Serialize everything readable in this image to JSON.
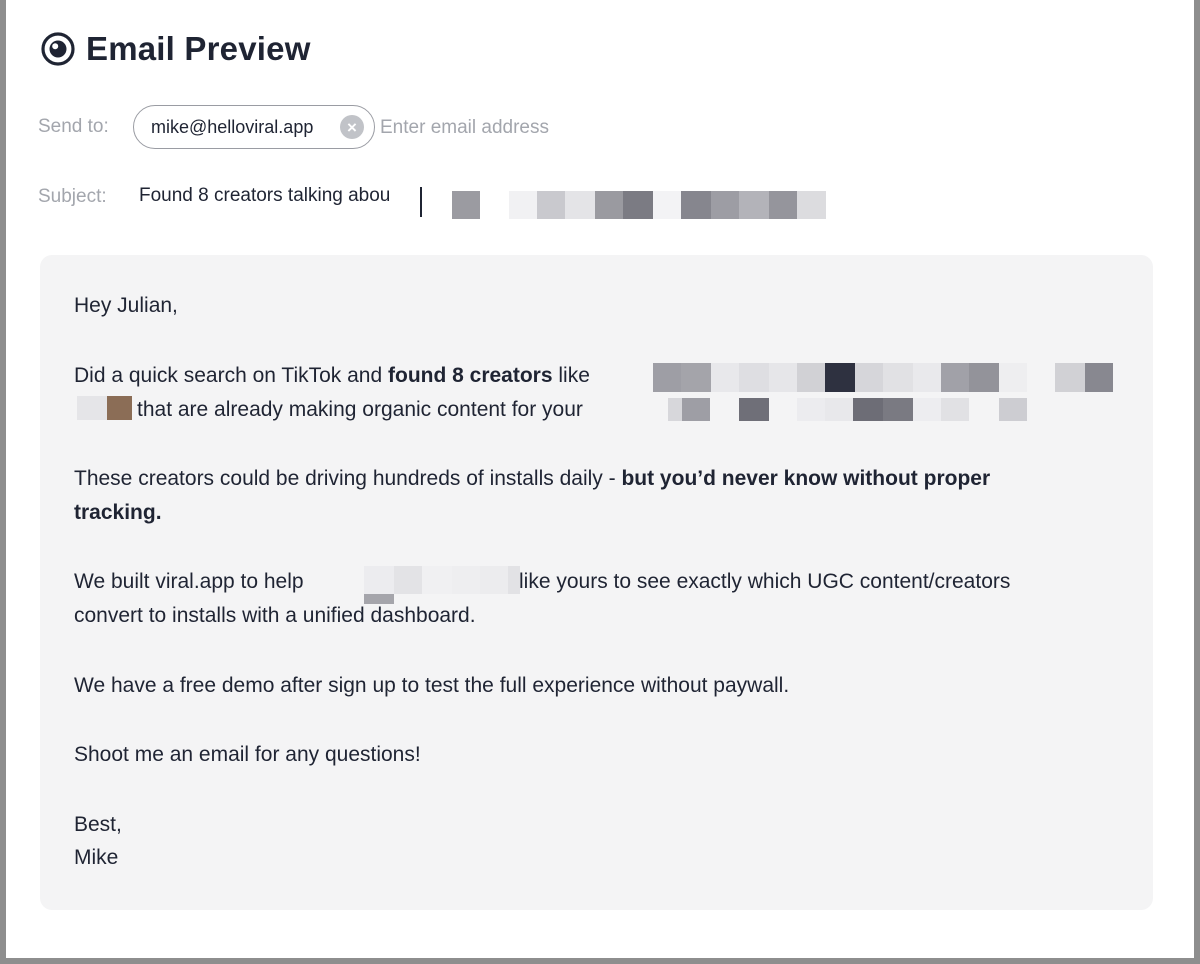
{
  "header": {
    "title": "Email Preview",
    "icon": "eye-icon"
  },
  "recipients": {
    "label": "Send to:",
    "chips": [
      {
        "email": "mike@helloviral.app"
      }
    ],
    "placeholder": "Enter email address"
  },
  "subject": {
    "label": "Subject:",
    "value": "Found 8 creators talking abou"
  },
  "body": {
    "greeting": "Hey Julian,",
    "p1": {
      "text_a": "Did a quick search on TikTok and ",
      "bold": "found 8 creators",
      "text_b": " like",
      "line2": "that are already making organic content for your"
    },
    "p2": {
      "text": "These creators could be driving hundreds of installs daily - ",
      "bold_a": "but you’d never know without proper",
      "bold_b": "tracking."
    },
    "p3": {
      "text_a": "We built viral.app to help",
      "text_b": "like yours to see exactly which UGC content/creators",
      "line2": "convert to installs with a unified dashboard."
    },
    "p4": "We have a free demo after sign up to test the full experience without paywall.",
    "p5": "Shoot me an email for any questions!",
    "signoff": "Best,",
    "signature": "Mike"
  },
  "colors": {
    "text": "#1f2433",
    "muted": "#a3a6ad",
    "card_bg": "#f4f4f5",
    "frame": "#8e8e8e"
  }
}
